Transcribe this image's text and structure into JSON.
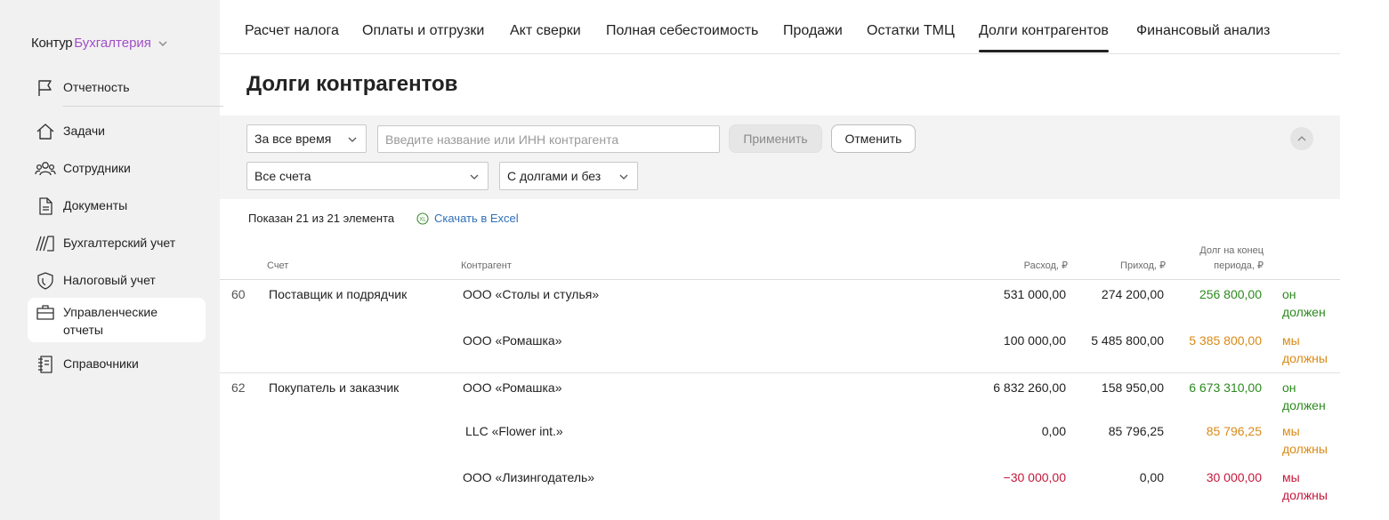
{
  "brand": {
    "part1": "Контур",
    "part2": "Бухгалтерия"
  },
  "sidebar": {
    "items": [
      {
        "label": "Отчетность",
        "icon": "flag-icon"
      },
      {
        "label": "Задачи",
        "icon": "home-icon"
      },
      {
        "label": "Сотрудники",
        "icon": "users-icon"
      },
      {
        "label": "Документы",
        "icon": "document-icon"
      },
      {
        "label": "Бухгалтерский учет",
        "icon": "ledger-icon"
      },
      {
        "label": "Налоговый учет",
        "icon": "shield-icon"
      },
      {
        "label": "Управленческие отчеты",
        "icon": "briefcase-icon"
      },
      {
        "label": "Справочники",
        "icon": "notebook-icon"
      }
    ]
  },
  "tabs": [
    {
      "label": "Расчет налога"
    },
    {
      "label": "Оплаты и отгрузки"
    },
    {
      "label": "Акт сверки"
    },
    {
      "label": "Полная себестоимость"
    },
    {
      "label": "Продажи"
    },
    {
      "label": "Остатки ТМЦ"
    },
    {
      "label": "Долги контрагентов"
    },
    {
      "label": "Финансовый анализ"
    }
  ],
  "page_title": "Долги контрагентов",
  "filters": {
    "period": "За все время",
    "search_placeholder": "Введите название или ИНН контрагента",
    "apply": "Применить",
    "cancel": "Отменить",
    "accounts": "Все счета",
    "debts": "С долгами и без"
  },
  "summary": "Показан 21 из 21 элемента",
  "excel_link": "Скачать в Excel",
  "table": {
    "headers": {
      "account": "Счет",
      "counterparty": "Контрагент",
      "expense": "Расход, ₽",
      "income": "Приход, ₽",
      "debt_line1": "Долг на конец",
      "debt_line2": "периода, ₽"
    },
    "groups": [
      {
        "code": "60",
        "name": "Поставщик и подрядчик",
        "rows": [
          {
            "counterparty": "ООО «Столы и стулья»",
            "expense": "531 000,00",
            "income": "274 200,00",
            "debt": "256 800,00",
            "status1": "он",
            "status2": "должен"
          },
          {
            "counterparty": "ООО «Ромашка»",
            "expense": "100 000,00",
            "income": "5 485 800,00",
            "debt": "5 385 800,00",
            "status1": "мы",
            "status2": "должны"
          }
        ]
      },
      {
        "code": "62",
        "name": "Покупатель и заказчик",
        "rows": [
          {
            "counterparty": "ООО «Ромашка»",
            "expense": "6 832 260,00",
            "income": "158 950,00",
            "debt": "6 673 310,00",
            "status1": "он",
            "status2": "должен"
          },
          {
            "counterparty": "LLC «Flower int.»",
            "expense": "0,00",
            "income": "85 796,25",
            "debt": "85 796,25",
            "status1": "мы",
            "status2": "должны"
          },
          {
            "counterparty": "ООО «Лизингодатель»",
            "expense": "−30 000,00",
            "income": "0,00",
            "debt": "30 000,00",
            "status1": "мы",
            "status2": "должны"
          }
        ]
      }
    ]
  },
  "colors": {
    "accent": "#a24fc6",
    "link": "#2f6fb8",
    "positive": "#2c8a1e",
    "warning": "#d98a17",
    "negative": "#c4183c"
  }
}
